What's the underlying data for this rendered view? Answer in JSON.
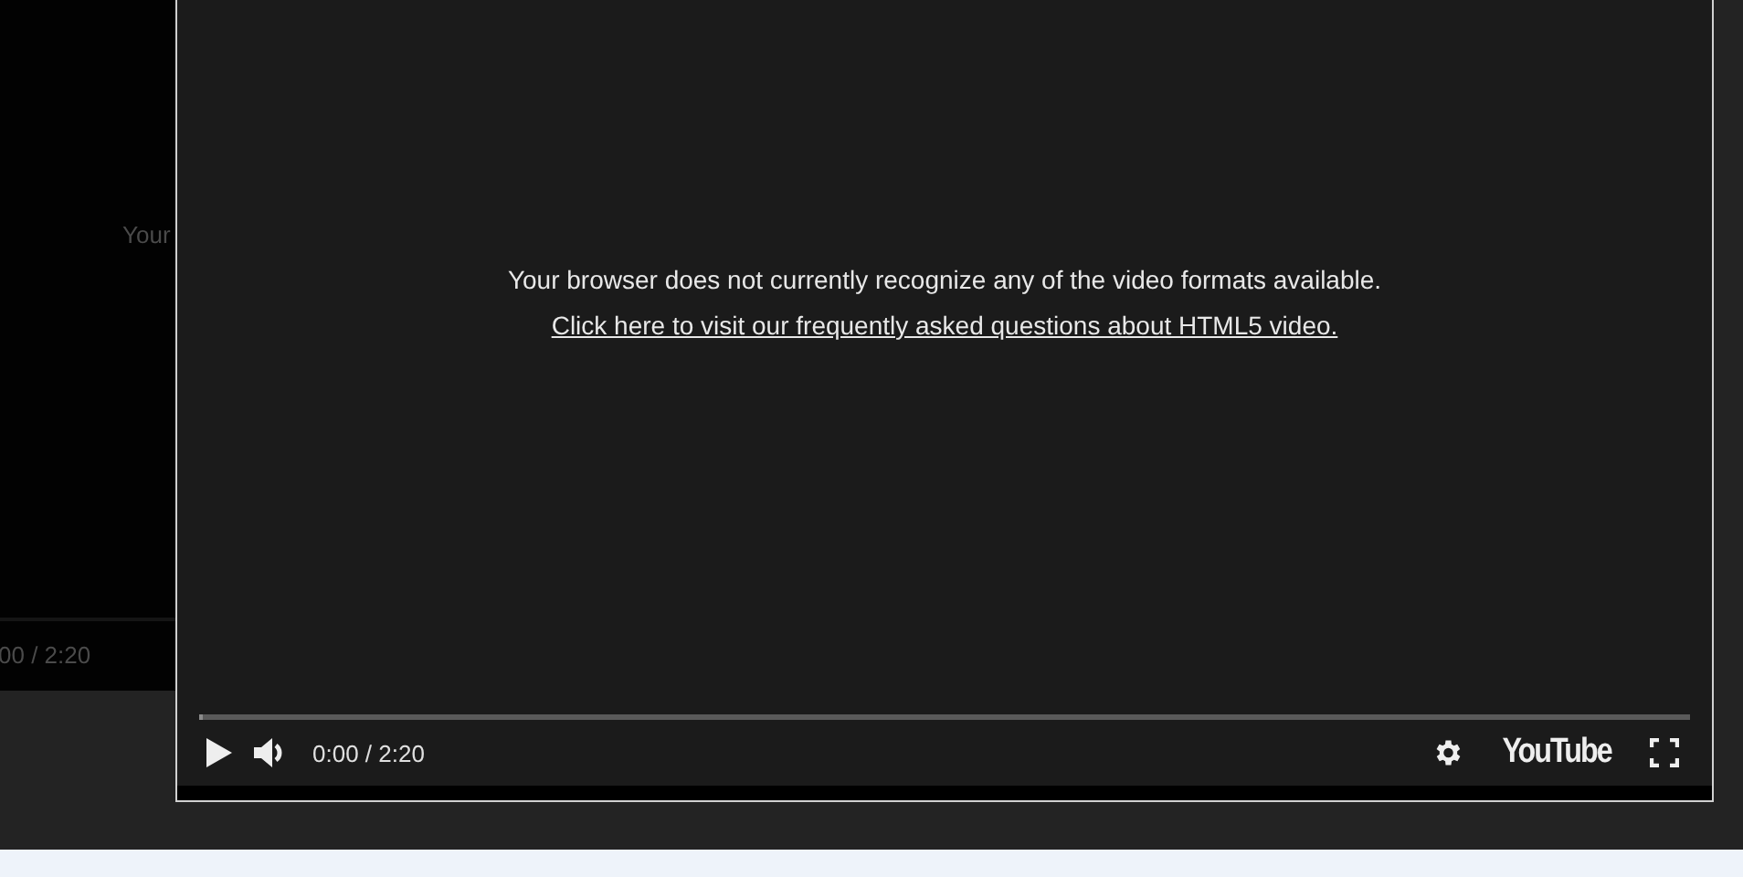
{
  "back_player": {
    "message": "Your",
    "time": "00 / 2:20"
  },
  "player": {
    "message": "Your browser does not currently recognize any of the video formats available.",
    "link": "Click here to visit our frequently asked questions about HTML5 video.",
    "progress": {
      "level": 0
    },
    "time": "0:00 / 2:20",
    "brand": "YouTube"
  }
}
